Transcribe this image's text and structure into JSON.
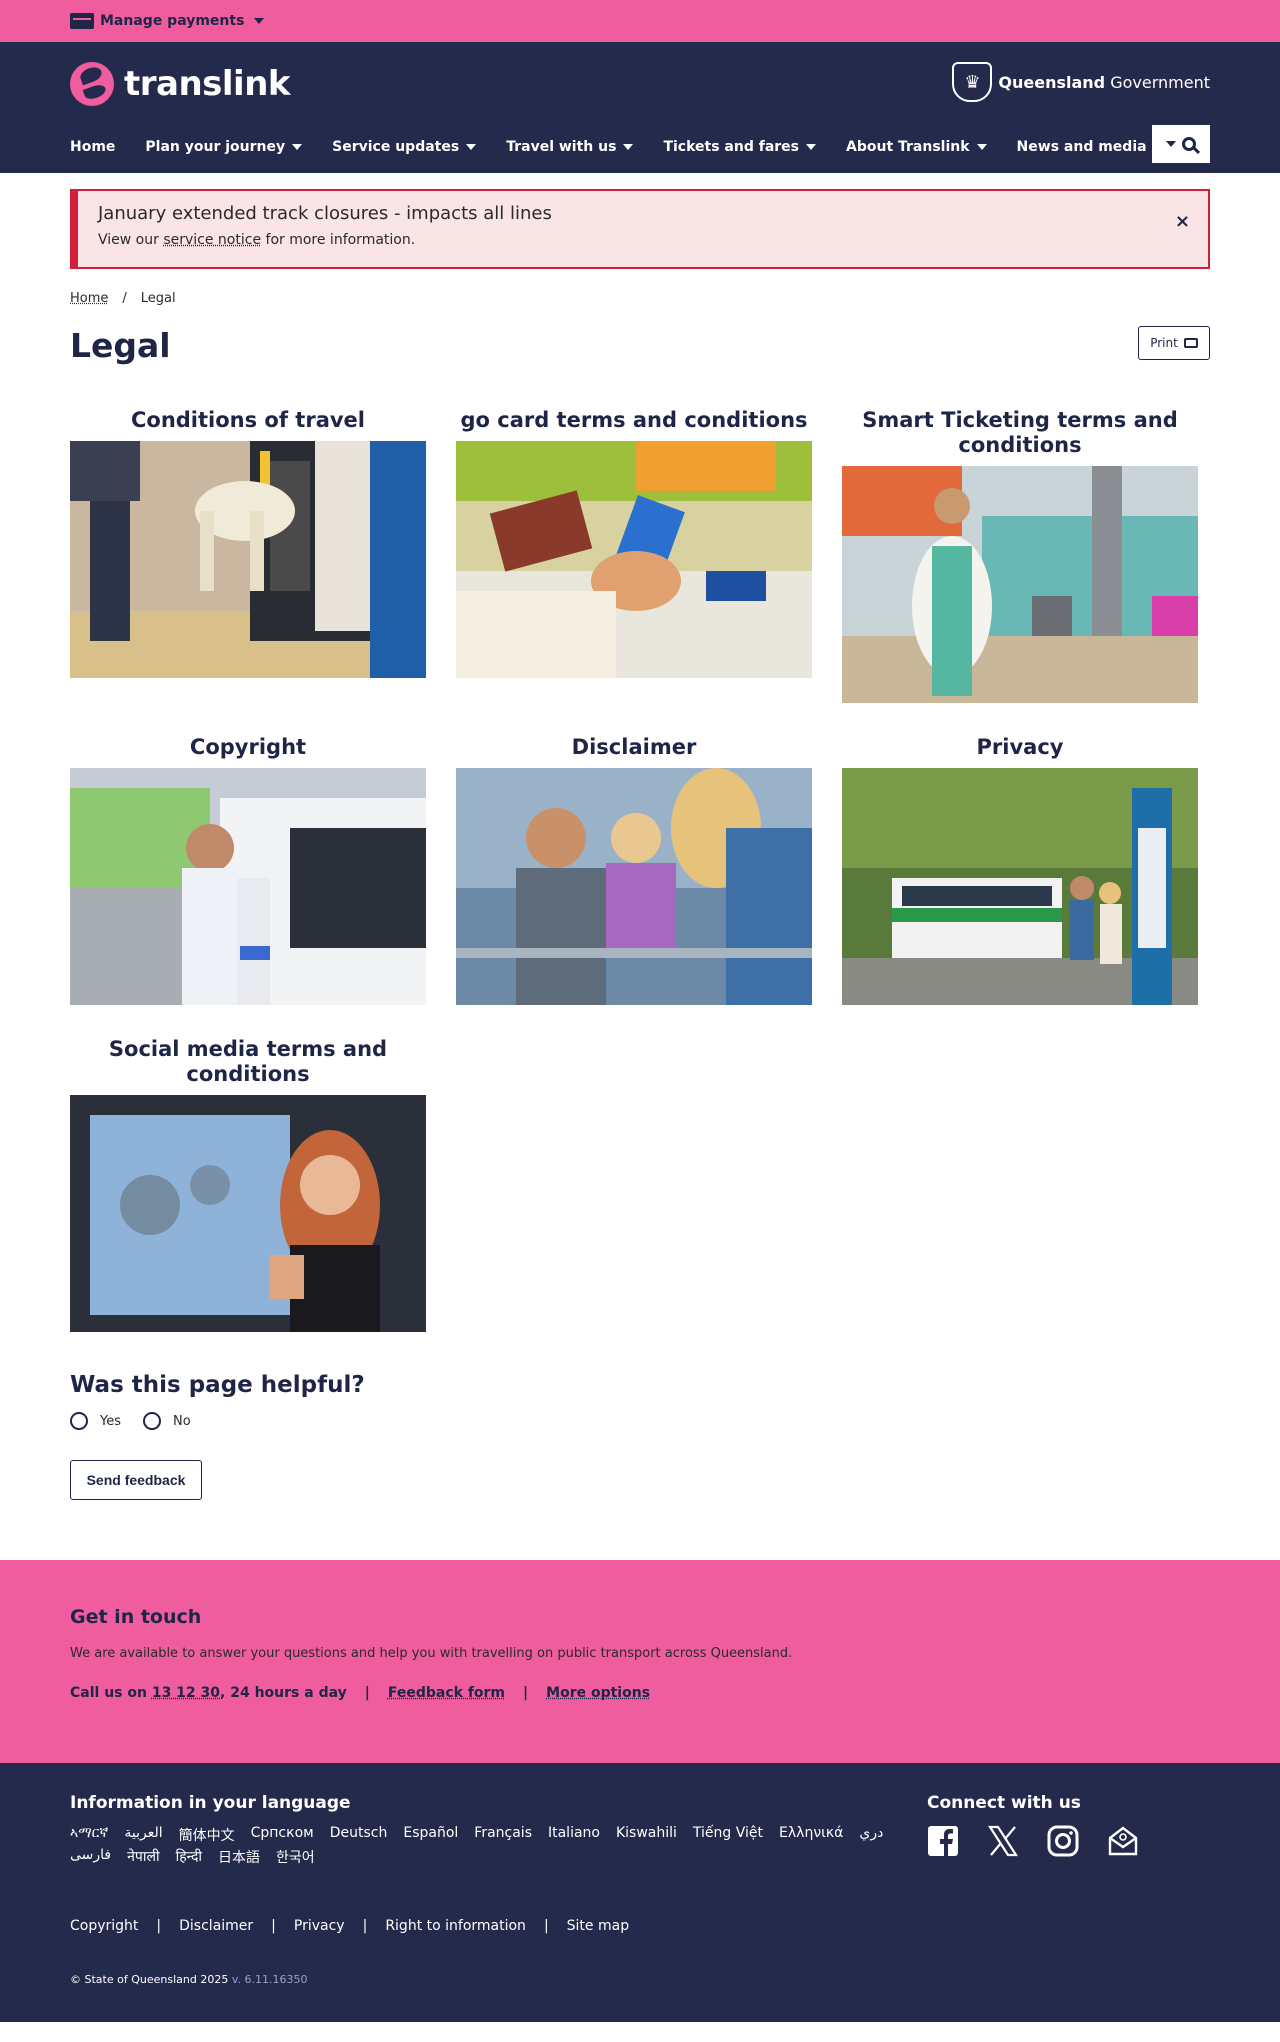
{
  "topbar": {
    "manage_payments": "Manage payments"
  },
  "header": {
    "logo_text": "translink",
    "gov_bold": "Queensland",
    "gov_rest": " Government",
    "nav": [
      {
        "label": "Home"
      },
      {
        "label": "Plan your journey"
      },
      {
        "label": "Service updates"
      },
      {
        "label": "Travel with us"
      },
      {
        "label": "Tickets and fares"
      },
      {
        "label": "About Translink"
      },
      {
        "label": "News and media"
      }
    ]
  },
  "alert": {
    "title": "January extended track closures - impacts all lines",
    "body_pre": "View our ",
    "body_link": "service notice",
    "body_post": " for more information.",
    "close": "×"
  },
  "breadcrumb": {
    "home": "Home",
    "sep": "/",
    "current": "Legal"
  },
  "page": {
    "title": "Legal",
    "print": "Print"
  },
  "tiles": [
    {
      "title": "Conditions of travel"
    },
    {
      "title": "go card terms and conditions"
    },
    {
      "title": "Smart Ticketing terms and conditions"
    },
    {
      "title": "Copyright"
    },
    {
      "title": "Disclaimer"
    },
    {
      "title": "Privacy"
    },
    {
      "title": "Social media terms and conditions"
    }
  ],
  "feedback": {
    "question": "Was this page helpful?",
    "yes": "Yes",
    "no": "No",
    "send": "Send feedback"
  },
  "get_in_touch": {
    "heading": "Get in touch",
    "text": "We are available to answer your questions and help you with travelling on public transport across Queensland.",
    "call_pre": "Call us on ",
    "call_number": "13 12 30",
    "call_post": ", 24 hours a day",
    "sep": "|",
    "feedback_form": "Feedback form",
    "more_options": "More options"
  },
  "footer": {
    "lang_heading": "Information in your language",
    "languages": [
      "ኣማርኛ",
      "العربية",
      "簡体中文",
      "Српском",
      "Deutsch",
      "Español",
      "Français",
      "Italiano",
      "Kiswahili",
      "Tiếng Việt",
      "Ελληνικά",
      "دري",
      "فارسی",
      "नेपाली",
      "हिन्दी",
      "日本語",
      "한국어"
    ],
    "connect": "Connect with us",
    "social": [
      {
        "icon": "facebook-icon",
        "glyph": "f"
      },
      {
        "icon": "x-icon",
        "glyph": "✕"
      },
      {
        "icon": "instagram-icon",
        "glyph": "◎"
      },
      {
        "icon": "email-icon",
        "glyph": "✉"
      }
    ],
    "links": [
      "Copyright",
      "Disclaimer",
      "Privacy",
      "Right to information",
      "Site map"
    ],
    "sep": "|",
    "copyright": "© State of Queensland 2025",
    "version": "v. 6.11.16350"
  },
  "colors": {
    "pink": "#ef5d9e",
    "navy": "#242a4b",
    "alert_red": "#d41f3a"
  }
}
